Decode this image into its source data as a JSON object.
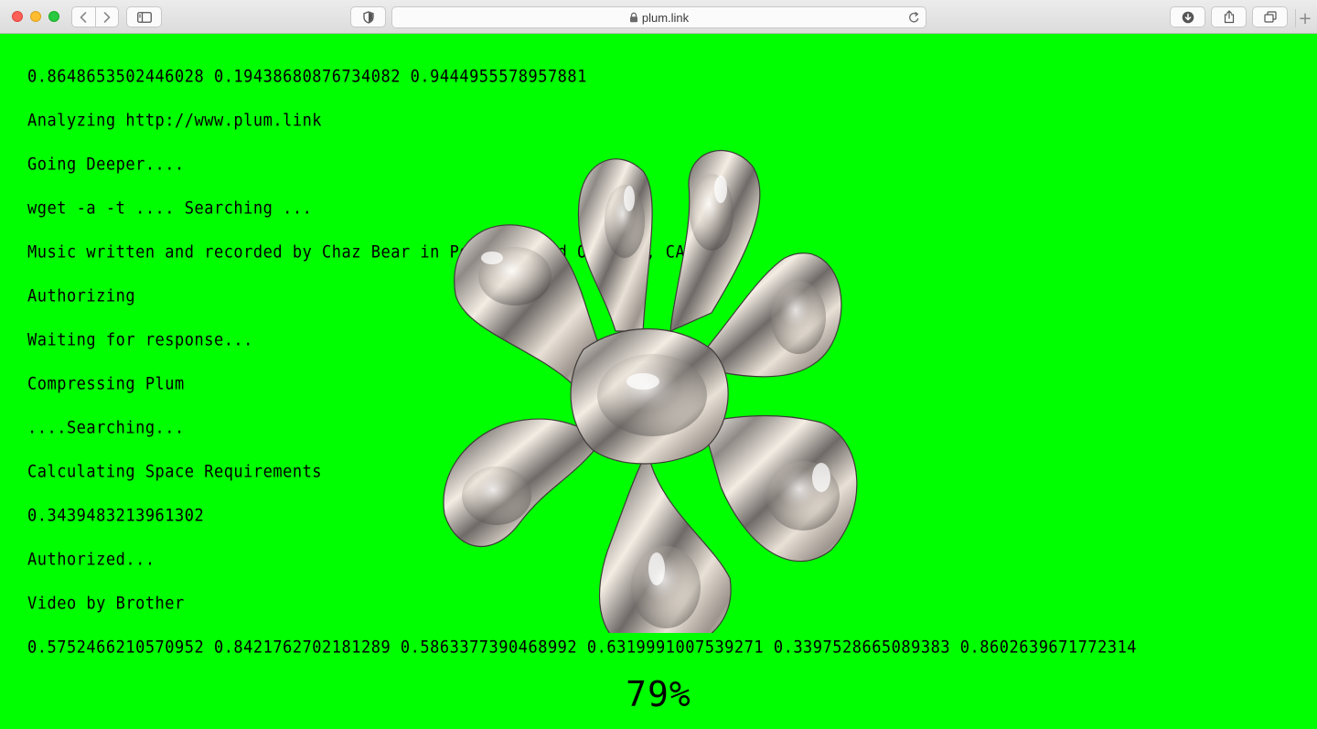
{
  "browser": {
    "url": "plum.link",
    "icons": {
      "back": "chevron-left-icon",
      "forward": "chevron-right-icon",
      "sidebar": "sidebar-icon",
      "shield": "shield-icon",
      "lock": "lock-icon",
      "reload": "reload-icon",
      "downloads": "download-icon",
      "share": "share-icon",
      "tabs": "tabs-overview-icon",
      "new_tab": "plus-icon"
    }
  },
  "page": {
    "background": "#00ff00",
    "log_lines": [
      "0.8648653502446028 0.19438680876734082 0.9444955578957881",
      "Analyzing http://www.plum.link",
      "Going Deeper....",
      "wget -a -t .... Searching ...",
      "Music written and recorded by Chaz Bear in Portland and Oakland, CA",
      "Authorizing",
      "Waiting for response...",
      "Compressing Plum",
      "....Searching...",
      "Calculating Space Requirements",
      "0.3439483213961302",
      "Authorized...",
      "Video by Brother",
      "0.5752466210570952 0.8421762702181289 0.5863377390468992 0.6319991007539271 0.3397528665089383 0.8602639671772314"
    ],
    "progress": {
      "label": "79%",
      "value": 0.79
    },
    "artwork": "chrome-splat-image"
  }
}
